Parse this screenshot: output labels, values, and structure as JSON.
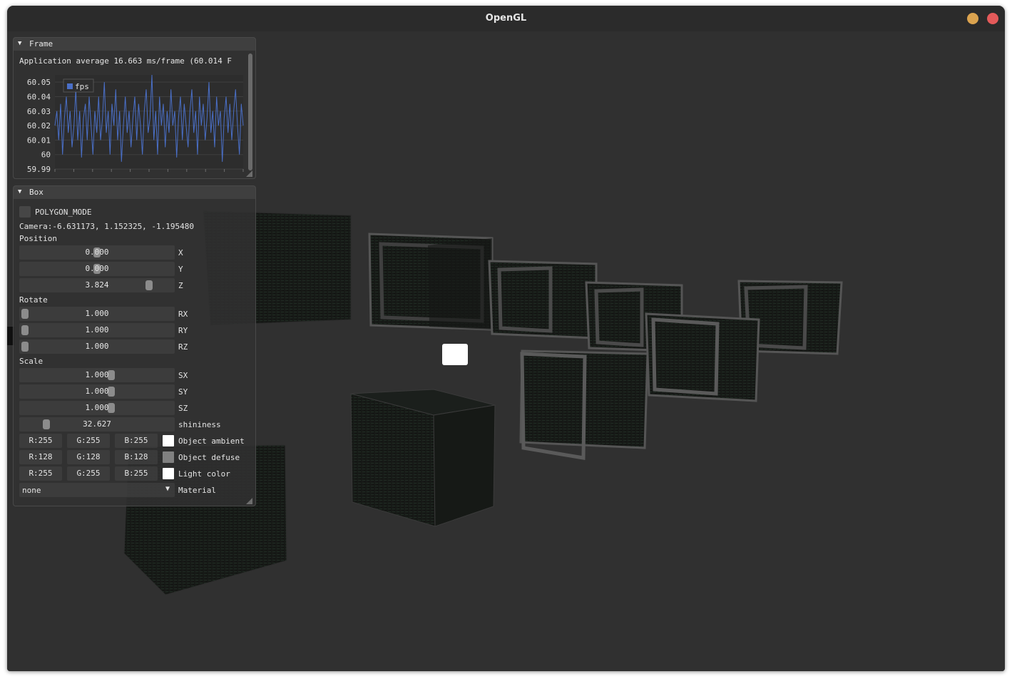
{
  "window": {
    "title": "OpenGL",
    "colors": {
      "minimize": "#dba34f",
      "close": "#e45a5a"
    }
  },
  "frame_panel": {
    "title": "Frame",
    "app_average": "Application average 16.663 ms/frame (60.014 F",
    "chart_data": {
      "type": "line",
      "title": "",
      "legend": [
        "fps"
      ],
      "legend_placement": "top-left",
      "xlabel": "",
      "ylabel": "",
      "ylim": [
        59.99,
        60.055
      ],
      "yticks": [
        "60.05",
        "60.04",
        "60.03",
        "60.02",
        "60.01",
        "60",
        "59.99"
      ],
      "grid": true,
      "series": [
        {
          "name": "fps",
          "color": "#4a6fc7",
          "values": [
            60.02,
            60.03,
            60.01,
            60.035,
            60.0,
            60.025,
            60.04,
            60.015,
            60.03,
            60.005,
            60.02,
            60.045,
            60.01,
            60.03,
            59.998,
            60.025,
            60.035,
            60.01,
            60.04,
            60.02,
            60.0,
            60.03,
            60.015,
            60.04,
            60.01,
            60.025,
            60.05,
            60.015,
            60.03,
            60.0,
            60.035,
            60.02,
            60.045,
            60.01,
            60.03,
            59.995,
            60.02,
            60.04,
            60.015,
            60.03,
            60.005,
            60.025,
            60.04,
            60.01,
            60.035,
            60.02,
            60.0,
            60.03,
            60.045,
            60.015,
            60.025,
            60.055,
            60.01,
            60.03,
            60.0,
            60.04,
            60.02,
            60.035,
            60.005,
            60.03,
            60.015,
            60.045,
            60.02,
            60.03,
            59.998,
            60.025,
            60.04,
            60.01,
            60.035,
            60.02,
            60.005,
            60.03,
            60.045,
            60.015,
            60.03,
            60.0,
            60.04,
            60.02,
            60.035,
            60.01,
            60.025,
            60.05,
            60.015,
            60.03,
            60.005,
            60.04,
            60.02,
            60.03,
            59.995,
            60.025,
            60.04,
            60.015,
            60.035,
            60.01,
            60.03,
            60.045,
            60.02,
            60.0,
            60.035,
            60.02
          ]
        }
      ]
    }
  },
  "box_panel": {
    "title": "Box",
    "polygon_mode_label": "POLYGON_MODE",
    "camera": "Camera:-6.631173, 1.152325, -1.195480",
    "position_label": "Position",
    "rotate_label": "Rotate",
    "scale_label": "Scale",
    "sliders": {
      "x": {
        "value": "0.000",
        "label": "X",
        "fraction": 0.5
      },
      "y": {
        "value": "0.000",
        "label": "Y",
        "fraction": 0.5
      },
      "z": {
        "value": "3.824",
        "label": "Z",
        "fraction": 0.86
      },
      "rx": {
        "value": "1.000",
        "label": "RX",
        "fraction": 0.0
      },
      "ry": {
        "value": "1.000",
        "label": "RY",
        "fraction": 0.0
      },
      "rz": {
        "value": "1.000",
        "label": "RZ",
        "fraction": 0.0
      },
      "sx": {
        "value": "1.000",
        "label": "SX",
        "fraction": 0.6
      },
      "sy": {
        "value": "1.000",
        "label": "SY",
        "fraction": 0.6
      },
      "sz": {
        "value": "1.000",
        "label": "SZ",
        "fraction": 0.6
      },
      "shininess": {
        "value": "32.627",
        "label": "shininess",
        "fraction": 0.15
      }
    },
    "colors": {
      "object_ambient": {
        "r": "R:255",
        "g": "G:255",
        "b": "B:255",
        "label": "Object ambient",
        "swatch": "#ffffff"
      },
      "object_defuse": {
        "r": "R:128",
        "g": "G:128",
        "b": "B:128",
        "label": "Object defuse",
        "swatch": "#808080"
      },
      "light_color": {
        "r": "R:255",
        "g": "G:255",
        "b": "B:255",
        "label": "Light color",
        "swatch": "#ffffff"
      }
    },
    "material": {
      "value": "none",
      "label": "Material"
    }
  }
}
